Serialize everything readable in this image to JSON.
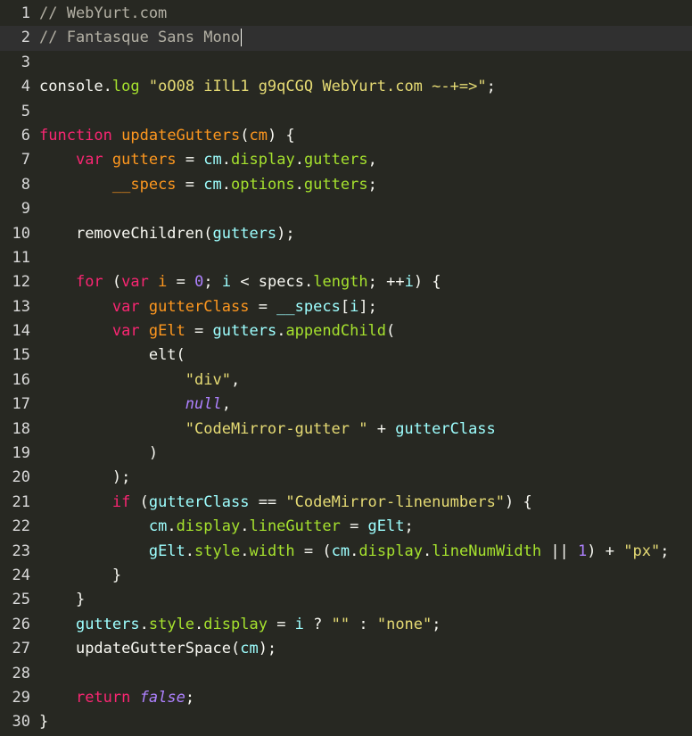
{
  "editor": {
    "active_line": 2,
    "colors": {
      "background": "#272822",
      "active_line": "#303030",
      "gutter_text": "#d9d9d9",
      "comment": "#b3b0a4",
      "keyword": "#f92672",
      "def": "#fd971f",
      "variable": "#a6e22e",
      "variable2": "#9effff",
      "string": "#e6db74",
      "number": "#ae81ff"
    },
    "lines": [
      {
        "number": "1",
        "tokens": [
          {
            "t": "// WebYurt.com",
            "c": "comment"
          }
        ]
      },
      {
        "number": "2",
        "tokens": [
          {
            "t": "// Fantasque Sans Mono",
            "c": "comment"
          }
        ]
      },
      {
        "number": "3",
        "tokens": []
      },
      {
        "number": "4",
        "tokens": [
          {
            "t": "console",
            "c": "plain"
          },
          {
            "t": ".",
            "c": "plain"
          },
          {
            "t": "log",
            "c": "property"
          },
          {
            "t": " ",
            "c": "plain"
          },
          {
            "t": "\"oO08 iIlL1 g9qCGQ WebYurt.com ~-+=>\"",
            "c": "string"
          },
          {
            "t": ";",
            "c": "plain"
          }
        ]
      },
      {
        "number": "5",
        "tokens": []
      },
      {
        "number": "6",
        "tokens": [
          {
            "t": "function",
            "c": "keyword"
          },
          {
            "t": " ",
            "c": "plain"
          },
          {
            "t": "updateGutters",
            "c": "def"
          },
          {
            "t": "(",
            "c": "plain"
          },
          {
            "t": "cm",
            "c": "def"
          },
          {
            "t": ") {",
            "c": "plain"
          }
        ]
      },
      {
        "number": "7",
        "tokens": [
          {
            "t": "    ",
            "c": "plain"
          },
          {
            "t": "var",
            "c": "keyword"
          },
          {
            "t": " ",
            "c": "plain"
          },
          {
            "t": "gutters",
            "c": "def"
          },
          {
            "t": " = ",
            "c": "plain"
          },
          {
            "t": "cm",
            "c": "variable2"
          },
          {
            "t": ".",
            "c": "plain"
          },
          {
            "t": "display",
            "c": "property"
          },
          {
            "t": ".",
            "c": "plain"
          },
          {
            "t": "gutters",
            "c": "property"
          },
          {
            "t": ",",
            "c": "plain"
          }
        ]
      },
      {
        "number": "8",
        "tokens": [
          {
            "t": "        ",
            "c": "plain"
          },
          {
            "t": "__specs",
            "c": "def"
          },
          {
            "t": " = ",
            "c": "plain"
          },
          {
            "t": "cm",
            "c": "variable2"
          },
          {
            "t": ".",
            "c": "plain"
          },
          {
            "t": "options",
            "c": "property"
          },
          {
            "t": ".",
            "c": "plain"
          },
          {
            "t": "gutters",
            "c": "property"
          },
          {
            "t": ";",
            "c": "plain"
          }
        ]
      },
      {
        "number": "9",
        "tokens": []
      },
      {
        "number": "10",
        "tokens": [
          {
            "t": "    ",
            "c": "plain"
          },
          {
            "t": "removeChildren",
            "c": "plain"
          },
          {
            "t": "(",
            "c": "plain"
          },
          {
            "t": "gutters",
            "c": "variable2"
          },
          {
            "t": ");",
            "c": "plain"
          }
        ]
      },
      {
        "number": "11",
        "tokens": []
      },
      {
        "number": "12",
        "tokens": [
          {
            "t": "    ",
            "c": "plain"
          },
          {
            "t": "for",
            "c": "keyword"
          },
          {
            "t": " (",
            "c": "plain"
          },
          {
            "t": "var",
            "c": "keyword"
          },
          {
            "t": " ",
            "c": "plain"
          },
          {
            "t": "i",
            "c": "def"
          },
          {
            "t": " = ",
            "c": "plain"
          },
          {
            "t": "0",
            "c": "number"
          },
          {
            "t": "; ",
            "c": "plain"
          },
          {
            "t": "i",
            "c": "variable2"
          },
          {
            "t": " < ",
            "c": "plain"
          },
          {
            "t": "specs",
            "c": "plain"
          },
          {
            "t": ".",
            "c": "plain"
          },
          {
            "t": "length",
            "c": "property"
          },
          {
            "t": "; ++",
            "c": "plain"
          },
          {
            "t": "i",
            "c": "variable2"
          },
          {
            "t": ") {",
            "c": "plain"
          }
        ]
      },
      {
        "number": "13",
        "tokens": [
          {
            "t": "        ",
            "c": "plain"
          },
          {
            "t": "var",
            "c": "keyword"
          },
          {
            "t": " ",
            "c": "plain"
          },
          {
            "t": "gutterClass",
            "c": "def"
          },
          {
            "t": " = ",
            "c": "plain"
          },
          {
            "t": "__specs",
            "c": "variable2"
          },
          {
            "t": "[",
            "c": "plain"
          },
          {
            "t": "i",
            "c": "variable2"
          },
          {
            "t": "];",
            "c": "plain"
          }
        ]
      },
      {
        "number": "14",
        "tokens": [
          {
            "t": "        ",
            "c": "plain"
          },
          {
            "t": "var",
            "c": "keyword"
          },
          {
            "t": " ",
            "c": "plain"
          },
          {
            "t": "gElt",
            "c": "def"
          },
          {
            "t": " = ",
            "c": "plain"
          },
          {
            "t": "gutters",
            "c": "variable2"
          },
          {
            "t": ".",
            "c": "plain"
          },
          {
            "t": "appendChild",
            "c": "property"
          },
          {
            "t": "(",
            "c": "plain"
          }
        ]
      },
      {
        "number": "15",
        "tokens": [
          {
            "t": "            ",
            "c": "plain"
          },
          {
            "t": "elt",
            "c": "plain"
          },
          {
            "t": "(",
            "c": "plain"
          }
        ]
      },
      {
        "number": "16",
        "tokens": [
          {
            "t": "                ",
            "c": "plain"
          },
          {
            "t": "\"div\"",
            "c": "string"
          },
          {
            "t": ",",
            "c": "plain"
          }
        ]
      },
      {
        "number": "17",
        "tokens": [
          {
            "t": "                ",
            "c": "plain"
          },
          {
            "t": "null",
            "c": "atom"
          },
          {
            "t": ",",
            "c": "plain"
          }
        ]
      },
      {
        "number": "18",
        "tokens": [
          {
            "t": "                ",
            "c": "plain"
          },
          {
            "t": "\"CodeMirror-gutter \"",
            "c": "string"
          },
          {
            "t": " + ",
            "c": "plain"
          },
          {
            "t": "gutterClass",
            "c": "variable2"
          }
        ]
      },
      {
        "number": "19",
        "tokens": [
          {
            "t": "            ",
            "c": "plain"
          },
          {
            "t": ")",
            "c": "plain"
          }
        ]
      },
      {
        "number": "20",
        "tokens": [
          {
            "t": "        ",
            "c": "plain"
          },
          {
            "t": ");",
            "c": "plain"
          }
        ]
      },
      {
        "number": "21",
        "tokens": [
          {
            "t": "        ",
            "c": "plain"
          },
          {
            "t": "if",
            "c": "keyword"
          },
          {
            "t": " (",
            "c": "plain"
          },
          {
            "t": "gutterClass",
            "c": "variable2"
          },
          {
            "t": " == ",
            "c": "plain"
          },
          {
            "t": "\"CodeMirror-linenumbers\"",
            "c": "string"
          },
          {
            "t": ") {",
            "c": "plain"
          }
        ]
      },
      {
        "number": "22",
        "tokens": [
          {
            "t": "            ",
            "c": "plain"
          },
          {
            "t": "cm",
            "c": "variable2"
          },
          {
            "t": ".",
            "c": "plain"
          },
          {
            "t": "display",
            "c": "property"
          },
          {
            "t": ".",
            "c": "plain"
          },
          {
            "t": "lineGutter",
            "c": "property"
          },
          {
            "t": " = ",
            "c": "plain"
          },
          {
            "t": "gElt",
            "c": "variable2"
          },
          {
            "t": ";",
            "c": "plain"
          }
        ]
      },
      {
        "number": "23",
        "tokens": [
          {
            "t": "            ",
            "c": "plain"
          },
          {
            "t": "gElt",
            "c": "variable2"
          },
          {
            "t": ".",
            "c": "plain"
          },
          {
            "t": "style",
            "c": "property"
          },
          {
            "t": ".",
            "c": "plain"
          },
          {
            "t": "width",
            "c": "property"
          },
          {
            "t": " = (",
            "c": "plain"
          },
          {
            "t": "cm",
            "c": "variable2"
          },
          {
            "t": ".",
            "c": "plain"
          },
          {
            "t": "display",
            "c": "property"
          },
          {
            "t": ".",
            "c": "plain"
          },
          {
            "t": "lineNumWidth",
            "c": "property"
          },
          {
            "t": " || ",
            "c": "plain"
          },
          {
            "t": "1",
            "c": "number"
          },
          {
            "t": ") + ",
            "c": "plain"
          },
          {
            "t": "\"px\"",
            "c": "string"
          },
          {
            "t": ";",
            "c": "plain"
          }
        ]
      },
      {
        "number": "24",
        "tokens": [
          {
            "t": "        ",
            "c": "plain"
          },
          {
            "t": "}",
            "c": "plain"
          }
        ]
      },
      {
        "number": "25",
        "tokens": [
          {
            "t": "    ",
            "c": "plain"
          },
          {
            "t": "}",
            "c": "plain"
          }
        ]
      },
      {
        "number": "26",
        "tokens": [
          {
            "t": "    ",
            "c": "plain"
          },
          {
            "t": "gutters",
            "c": "variable2"
          },
          {
            "t": ".",
            "c": "plain"
          },
          {
            "t": "style",
            "c": "property"
          },
          {
            "t": ".",
            "c": "plain"
          },
          {
            "t": "display",
            "c": "property"
          },
          {
            "t": " = ",
            "c": "plain"
          },
          {
            "t": "i",
            "c": "variable2"
          },
          {
            "t": " ? ",
            "c": "plain"
          },
          {
            "t": "\"\"",
            "c": "string"
          },
          {
            "t": " : ",
            "c": "plain"
          },
          {
            "t": "\"none\"",
            "c": "string"
          },
          {
            "t": ";",
            "c": "plain"
          }
        ]
      },
      {
        "number": "27",
        "tokens": [
          {
            "t": "    ",
            "c": "plain"
          },
          {
            "t": "updateGutterSpace",
            "c": "plain"
          },
          {
            "t": "(",
            "c": "plain"
          },
          {
            "t": "cm",
            "c": "variable2"
          },
          {
            "t": ");",
            "c": "plain"
          }
        ]
      },
      {
        "number": "28",
        "tokens": []
      },
      {
        "number": "29",
        "tokens": [
          {
            "t": "    ",
            "c": "plain"
          },
          {
            "t": "return",
            "c": "keyword"
          },
          {
            "t": " ",
            "c": "plain"
          },
          {
            "t": "false",
            "c": "atom"
          },
          {
            "t": ";",
            "c": "plain"
          }
        ]
      },
      {
        "number": "30",
        "tokens": [
          {
            "t": "}",
            "c": "plain"
          }
        ]
      }
    ]
  }
}
